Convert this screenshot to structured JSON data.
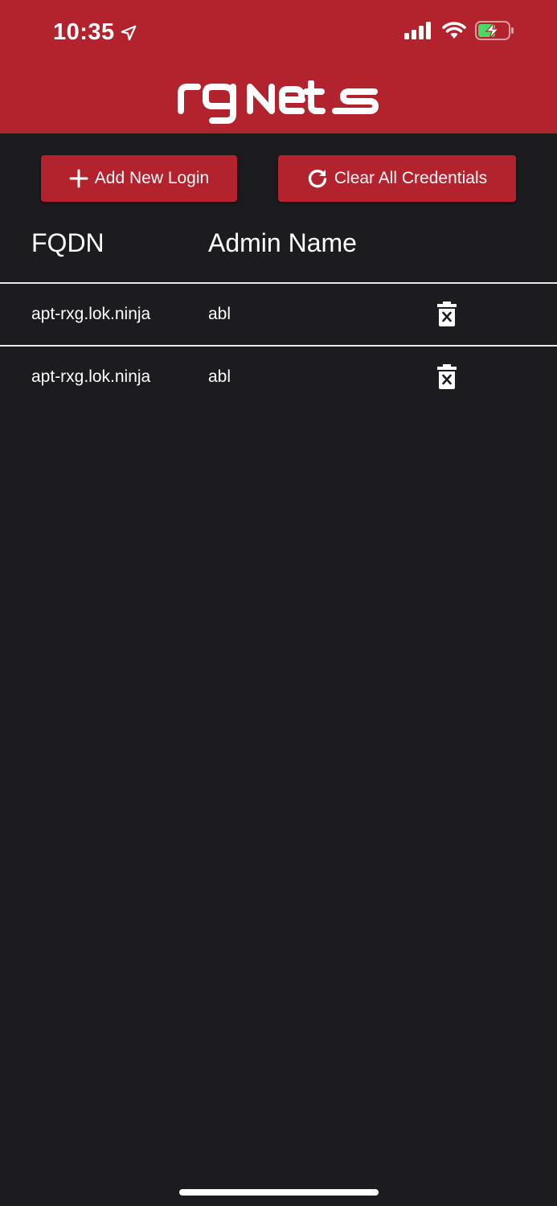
{
  "status_bar": {
    "time": "10:35",
    "icons": [
      "location-arrow-icon",
      "cellular-signal-icon",
      "wifi-icon",
      "battery-charging-icon"
    ]
  },
  "header": {
    "logo_text": "rgNets",
    "background_color": "#b3232e"
  },
  "actions": {
    "add_label": "Add New Login",
    "clear_label": "Clear All Credentials"
  },
  "table": {
    "columns": [
      "FQDN",
      "Admin Name"
    ],
    "rows": [
      {
        "fqdn": "apt-rxg.lok.ninja",
        "admin": "abl"
      },
      {
        "fqdn": "apt-rxg.lok.ninja",
        "admin": "abl"
      }
    ]
  },
  "colors": {
    "accent": "#b3232e",
    "background": "#1c1b20",
    "text": "#ffffff"
  }
}
